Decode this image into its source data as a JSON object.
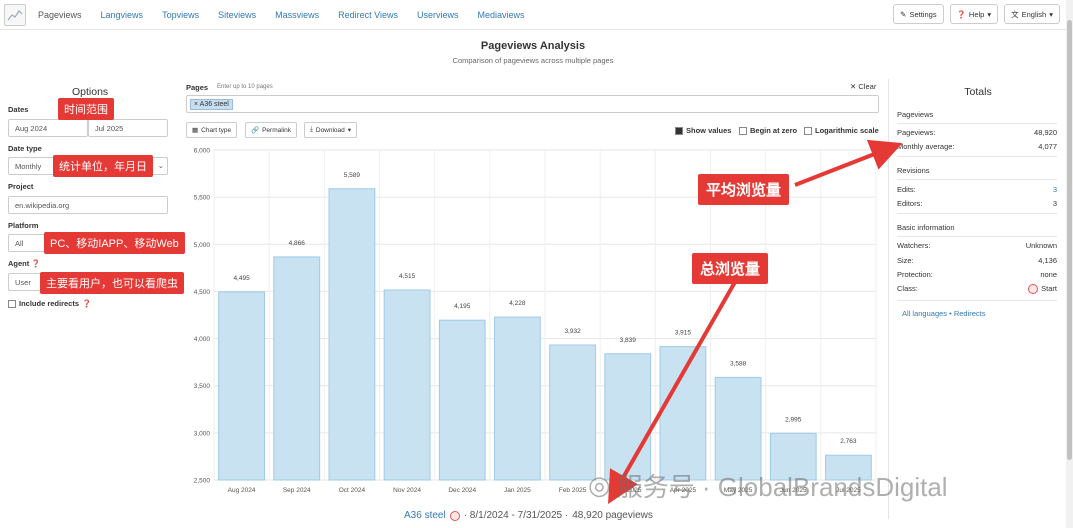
{
  "nav": {
    "links": [
      "Pageviews",
      "Langviews",
      "Topviews",
      "Siteviews",
      "Massviews",
      "Redirect Views",
      "Userviews",
      "Mediaviews"
    ],
    "settings": "Settings",
    "help": "Help",
    "language": "English"
  },
  "header": {
    "title": "Pageviews Analysis",
    "subtitle": "Comparison of pageviews across multiple pages"
  },
  "options": {
    "title": "Options",
    "dates_label": "Dates",
    "date_start": "Aug 2024",
    "date_end": "Jul 2025",
    "date_type_label": "Date type",
    "date_type": "Monthly",
    "project_label": "Project",
    "project": "en.wikipedia.org",
    "platform_label": "Platform",
    "platform": "All",
    "agent_label": "Agent",
    "agent": "User",
    "include_redirects": "Include redirects"
  },
  "pages": {
    "label": "Pages",
    "hint": "Enter up to 10 pages",
    "clear": "Clear",
    "chip": "A36 steel",
    "chart_type": "Chart type",
    "permalink": "Permalink",
    "download": "Download",
    "show_values": "Show values",
    "begin_at_zero": "Begin at zero",
    "log_scale": "Logarithmic scale"
  },
  "footer": {
    "page": "A36 steel",
    "range": "· 8/1/2024 - 7/31/2025 ·",
    "total": "48,920 pageviews"
  },
  "totals": {
    "title": "Totals",
    "pageviews_section": "Pageviews",
    "pageviews_label": "Pageviews:",
    "pageviews_value": "48,920",
    "monthly_label": "Monthly average:",
    "monthly_value": "4,077",
    "revisions_section": "Revisions",
    "edits_label": "Edits:",
    "edits_value": "3",
    "editors_label": "Editors:",
    "editors_value": "3",
    "basic_section": "Basic information",
    "watchers_label": "Watchers:",
    "watchers_value": "Unknown",
    "size_label": "Size:",
    "size_value": "4,136",
    "protection_label": "Protection:",
    "protection_value": "none",
    "class_label": "Class:",
    "class_value": "Start",
    "all_languages": "All languages",
    "redirects": "Redirects"
  },
  "annotations": {
    "dates_tag": "时间范围",
    "datetype_tag": "统计单位，年月日",
    "platform_tag": "PC、移动IAPP、移动Web",
    "agent_tag": "主要看用户，也可以看爬虫",
    "avg_tag": "平均浏览量",
    "total_tag": "总浏览量",
    "watermark": "服务号 · GlobalBrandsDigital"
  },
  "chart_data": {
    "type": "bar",
    "categories": [
      "Aug 2024",
      "Sep 2024",
      "Oct 2024",
      "Nov 2024",
      "Dec 2024",
      "Jan 2025",
      "Feb 2025",
      "Mar 2025",
      "Apr 2025",
      "May 2025",
      "Jun 2025",
      "Jul 2025"
    ],
    "values": [
      4495,
      4866,
      5589,
      4515,
      4195,
      4228,
      3932,
      3839,
      3915,
      3588,
      2995,
      2763
    ],
    "labels": [
      "4,495",
      "4,866",
      "5,589",
      "4,515",
      "4,195",
      "4,228",
      "3,932",
      "3,839",
      "3,915",
      "3,588",
      "2,995",
      "2,763"
    ],
    "yticks": [
      "2,500",
      "3,000",
      "3,500",
      "4,000",
      "4,500",
      "5,000",
      "5,500",
      "6,000"
    ],
    "ylim": [
      2500,
      6000
    ],
    "bar_color": "#c8e2f2",
    "bar_border": "#9fcbe6",
    "grid": true
  }
}
